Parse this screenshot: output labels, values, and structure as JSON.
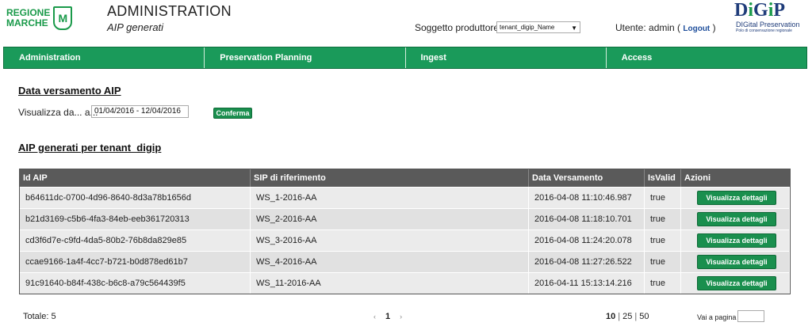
{
  "header": {
    "logo_line1": "REGIONE",
    "logo_line2": "MARCHE",
    "app_title": "ADMINISTRATION",
    "subtitle": "AIP generati",
    "producer_label": "Soggetto produttore:",
    "producer_value": "tenant_digip_Name",
    "user_prefix": "Utente: admin (",
    "logout_label": "Logout",
    "user_suffix": ")",
    "digip_brand": "DiGiP",
    "digip_tagline": "DIGital Preservation",
    "digip_subtagline": "Polo di conservazione regionale"
  },
  "nav": {
    "items": [
      {
        "label": "Administration"
      },
      {
        "label": "Preservation Planning"
      },
      {
        "label": "Ingest"
      },
      {
        "label": "Access"
      }
    ]
  },
  "filter": {
    "section_title": "Data versamento AIP",
    "date_label": "Visualizza da... a...",
    "date_value": "01/04/2016 - 12/04/2016",
    "confirm_label": "Conferma"
  },
  "results": {
    "section_title": "AIP generati per tenant_digip",
    "columns": [
      "Id AIP",
      "SIP di riferimento",
      "Data Versamento",
      "IsValid",
      "Azioni"
    ],
    "rows": [
      {
        "id": "b64611dc-0700-4d96-8640-8d3a78b1656d",
        "sip": "WS_1-2016-AA",
        "date": "2016-04-08 11:10:46.987",
        "valid": "true",
        "action": "Visualizza dettagli"
      },
      {
        "id": "b21d3169-c5b6-4fa3-84eb-eeb361720313",
        "sip": "WS_2-2016-AA",
        "date": "2016-04-08 11:18:10.701",
        "valid": "true",
        "action": "Visualizza dettagli"
      },
      {
        "id": "cd3f6d7e-c9fd-4da5-80b2-76b8da829e85",
        "sip": "WS_3-2016-AA",
        "date": "2016-04-08 11:24:20.078",
        "valid": "true",
        "action": "Visualizza dettagli"
      },
      {
        "id": "ccae9166-1a4f-4cc7-b721-b0d878ed61b7",
        "sip": "WS_4-2016-AA",
        "date": "2016-04-08 11:27:26.522",
        "valid": "true",
        "action": "Visualizza dettagli"
      },
      {
        "id": "91c91640-b84f-438c-b6c8-a79c564439f5",
        "sip": "WS_11-2016-AA",
        "date": "2016-04-11 15:13:14.216",
        "valid": "true",
        "action": "Visualizza dettagli"
      }
    ]
  },
  "footer": {
    "total_label": "Totale: 5",
    "prev_icon": "‹",
    "current_page": "1",
    "next_icon": "›",
    "page_sizes": [
      "10",
      "25",
      "50"
    ],
    "separator": "|",
    "goto_label": "Vai a pagina"
  },
  "colors": {
    "brand_green": "#1a9a5a",
    "button_green": "#1a8f4e",
    "table_header": "#5a5a5a",
    "link_blue": "#1f4f9c"
  }
}
